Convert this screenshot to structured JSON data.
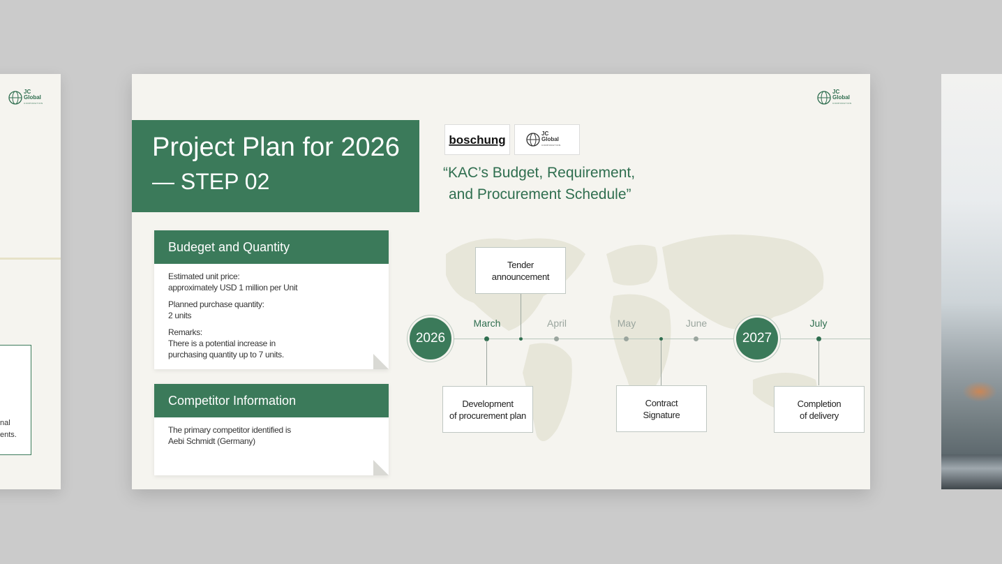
{
  "left_slide": {
    "logo": {
      "line1": "JC",
      "line2": "Global",
      "line3": "CORPORATION"
    },
    "fragment_lines": [
      "nal",
      "ents."
    ]
  },
  "main_slide": {
    "logo": {
      "line1": "JC",
      "line2": "Global",
      "line3": "CORPORATION"
    },
    "title_line1": "Project Plan for 2026",
    "title_line2": "— STEP 02",
    "partner_logo_text": "boschung",
    "partner_logo2": {
      "line1": "JC",
      "line2": "Global",
      "line3": "CORPORATION"
    },
    "quote_line1": "“KAC’s Budget, Requirement,",
    "quote_line2": "and Procurement Schedule”",
    "budget_card": {
      "title": "Budeget and Quantity",
      "item1_label": "Estimated unit price:",
      "item1_value": "approximately USD 1 million per Unit",
      "item2_label": "Planned purchase quantity:",
      "item2_value": "2 units",
      "item3_label": "Remarks:",
      "item3_value_line1": "There is a potential increase in",
      "item3_value_line2": "purchasing quantity up to 7 units."
    },
    "competitor_card": {
      "title": "Competitor Information",
      "line1": "The primary competitor identified is",
      "line2": "Aebi Schmidt (Germany)"
    },
    "timeline": {
      "year_start": "2026",
      "year_end": "2027",
      "months": {
        "march": "March",
        "april": "April",
        "may": "May",
        "june": "June",
        "july": "July"
      },
      "events": {
        "tender": {
          "line1": "Tender",
          "line2": "announcement"
        },
        "development": {
          "line1": "Development",
          "line2": "of procurement plan"
        },
        "contract": {
          "line1": "Contract",
          "line2": "Signature"
        },
        "completion": {
          "line1": "Completion",
          "line2": "of delivery"
        }
      }
    }
  },
  "colors": {
    "brand_green": "#3b7a5a",
    "slide_bg": "#f5f4ef",
    "desk_bg": "#cbcbcb"
  }
}
